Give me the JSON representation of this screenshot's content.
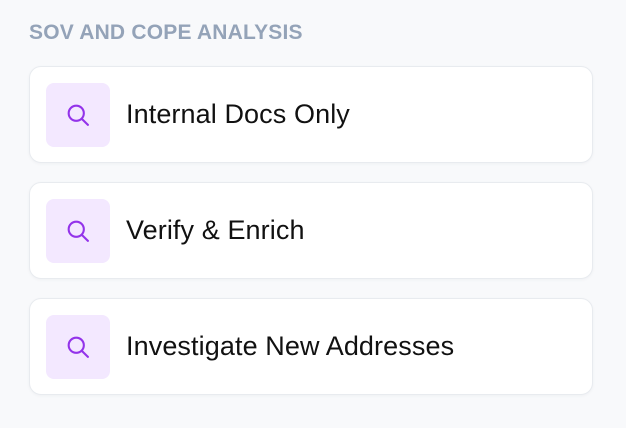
{
  "section": {
    "title": "SOV AND COPE ANALYSIS"
  },
  "colors": {
    "icon_accent": "#9333ea",
    "icon_background": "#f3e8ff",
    "title_color": "#94a3b8"
  },
  "cards": [
    {
      "label": "Internal Docs Only",
      "icon": "search-icon"
    },
    {
      "label": "Verify & Enrich",
      "icon": "search-icon"
    },
    {
      "label": "Investigate New Addresses",
      "icon": "search-icon"
    }
  ]
}
